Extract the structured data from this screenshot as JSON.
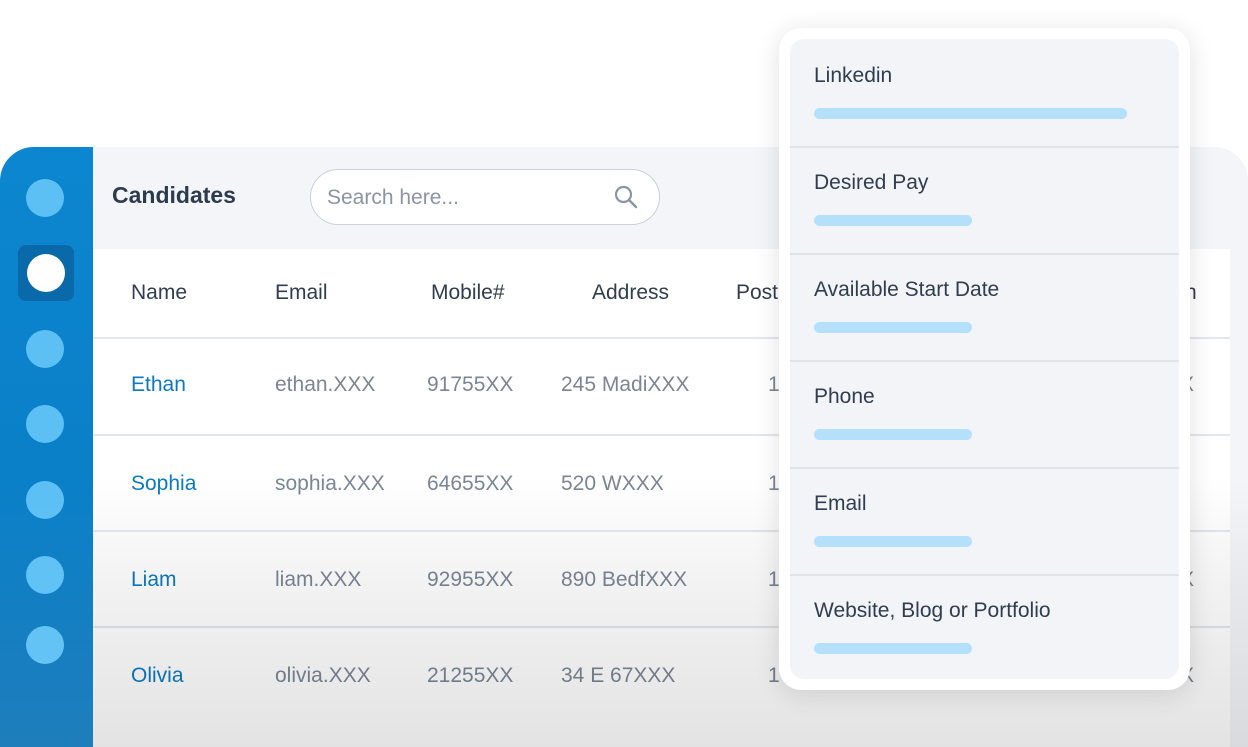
{
  "header": {
    "title": "Candidates",
    "search_placeholder": "Search here..."
  },
  "table": {
    "columns": [
      "Name",
      "Email",
      "Mobile#",
      "Address",
      "Post",
      "n"
    ],
    "rows": [
      {
        "name": "Ethan",
        "email": "ethan.XXX",
        "mobile": "91755XX",
        "address": "245 MadiXXX",
        "post": "1",
        "extra": "X"
      },
      {
        "name": "Sophia",
        "email": "sophia.XXX",
        "mobile": "64655XX",
        "address": "520 WXXX",
        "post": "1",
        "extra": ""
      },
      {
        "name": "Liam",
        "email": "liam.XXX",
        "mobile": "92955XX",
        "address": "890 BedfXXX",
        "post": "1",
        "extra": "X"
      },
      {
        "name": "Olivia",
        "email": "olivia.XXX",
        "mobile": "21255XX",
        "address": "34 E 67XXX",
        "post": "1",
        "extra": "X"
      }
    ]
  },
  "panel": {
    "fields": [
      {
        "label": "Linkedin"
      },
      {
        "label": "Desired Pay"
      },
      {
        "label": "Available Start Date"
      },
      {
        "label": "Phone"
      },
      {
        "label": "Email"
      },
      {
        "label": "Website, Blog or Portfolio"
      }
    ]
  },
  "colors": {
    "sidebar": "#0a7fc7",
    "accent": "#0b7ac2",
    "bar": "#b5e0fb"
  },
  "icons": [
    "search-icon"
  ]
}
